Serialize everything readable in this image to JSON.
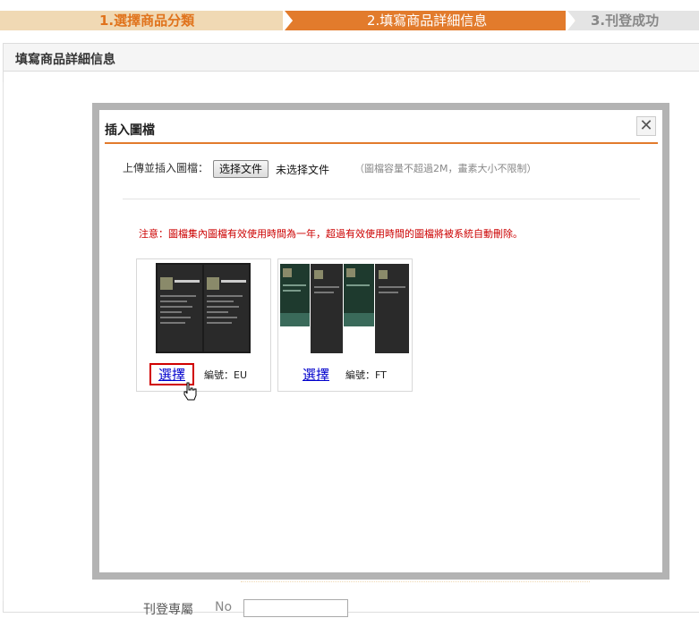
{
  "steps": {
    "step1": "1.選擇商品分類",
    "step2": "2.填寫商品詳細信息",
    "step3": "3.刊登成功"
  },
  "page": {
    "title": "填寫商品詳細信息",
    "bottom_label": "刊登専屬",
    "bottom_no": "No"
  },
  "modal": {
    "title": "插入圖檔",
    "close_icon": "close-icon",
    "upload_label": "上傳並插入圖檔：",
    "file_button": "选择文件",
    "file_status": "未选择文件",
    "upload_hint": "（圖檔容量不超過2M，畫素大小不限制）",
    "notice": "注意：圖檔集內圖檔有效使用時間為一年，超過有效使用時間的圖檔將被系統自動刪除。",
    "images": [
      {
        "select_label": "選擇",
        "code": "編號：EU",
        "highlighted": true
      },
      {
        "select_label": "選擇",
        "code": "編號：FT",
        "highlighted": false
      }
    ]
  },
  "colors": {
    "accent": "#e27b2c",
    "step1_bg": "#f0d9b4",
    "notice": "#cc0000",
    "highlight_border": "#d00000"
  }
}
